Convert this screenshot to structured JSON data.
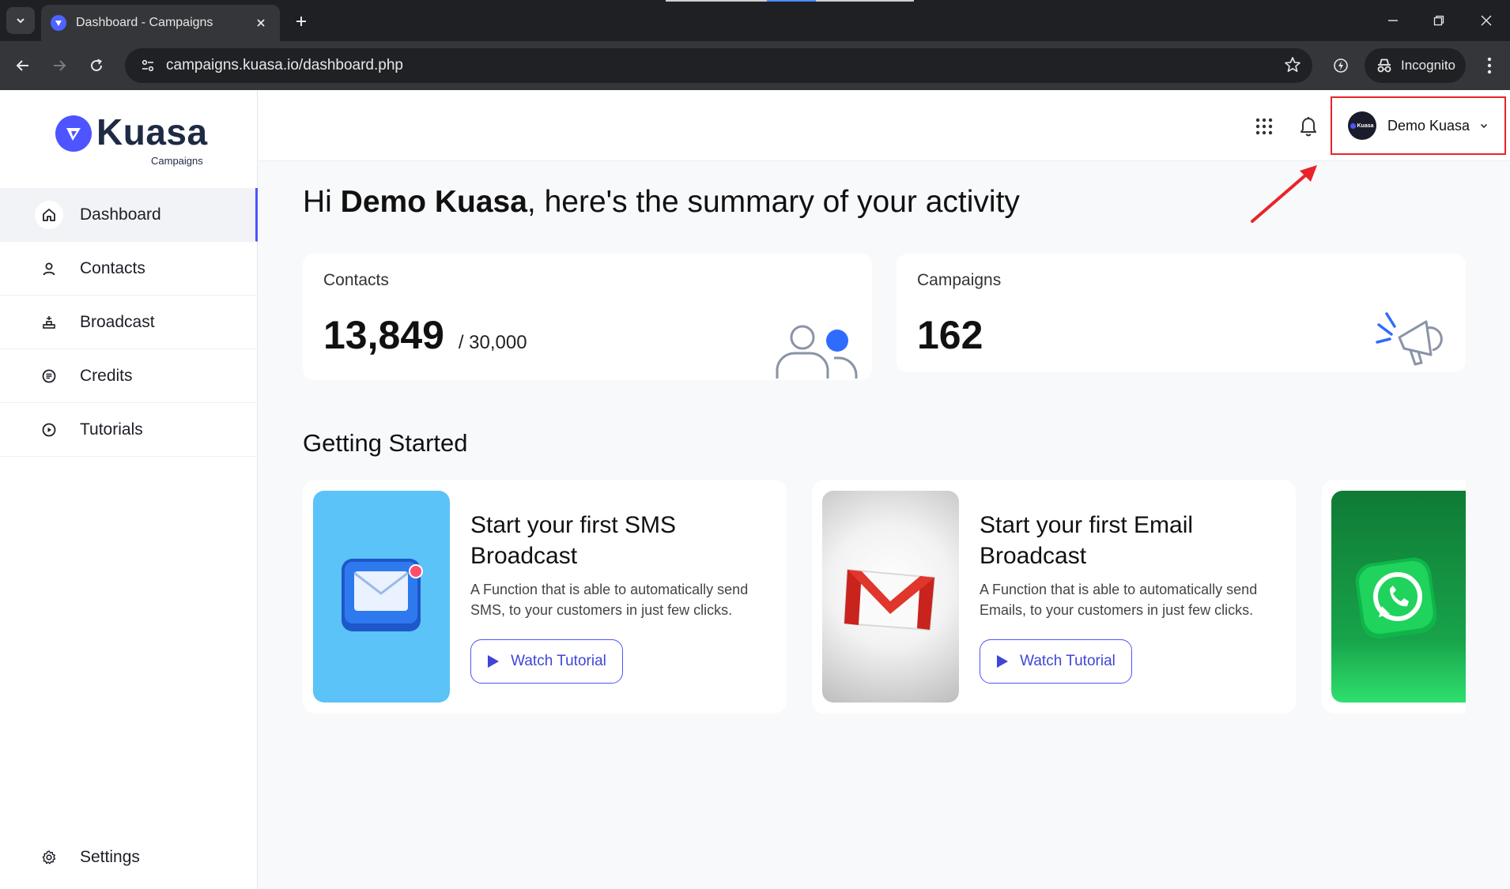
{
  "browser": {
    "tab_title": "Dashboard - Campaigns",
    "url": "campaigns.kuasa.io/dashboard.php",
    "incognito_label": "Incognito"
  },
  "sidebar": {
    "logo_text": "Kuasa",
    "logo_sub": "Campaigns",
    "items": [
      {
        "label": "Dashboard",
        "icon": "home-icon",
        "active": true
      },
      {
        "label": "Contacts",
        "icon": "person-icon"
      },
      {
        "label": "Broadcast",
        "icon": "broadcast-icon"
      },
      {
        "label": "Credits",
        "icon": "credits-icon"
      },
      {
        "label": "Tutorials",
        "icon": "play-circle-icon"
      }
    ],
    "settings_label": "Settings"
  },
  "topbar": {
    "user_name": "Demo Kuasa",
    "avatar_text": "Kuasa"
  },
  "greeting": {
    "prefix": "Hi ",
    "name": "Demo Kuasa",
    "suffix": ", here's the summary of your activity"
  },
  "stats": {
    "contacts": {
      "label": "Contacts",
      "value": "13,849",
      "total": "/ 30,000"
    },
    "campaigns": {
      "label": "Campaigns",
      "value": "162"
    }
  },
  "getting_started": {
    "title": "Getting Started",
    "cards": [
      {
        "title": "Start your first SMS Broadcast",
        "description": "A Function that is able to automatically send SMS, to your customers in just few clicks.",
        "button": "Watch Tutorial",
        "thumb_color": "#5bc3f8"
      },
      {
        "title": "Start your first Email Broadcast",
        "description": "A Function that is able to automatically send Emails, to your customers in just few clicks.",
        "button": "Watch Tutorial",
        "thumb_color": "#e6e6e6"
      }
    ]
  },
  "colors": {
    "accent": "#4e54ff",
    "annotation": "#e8242a"
  }
}
